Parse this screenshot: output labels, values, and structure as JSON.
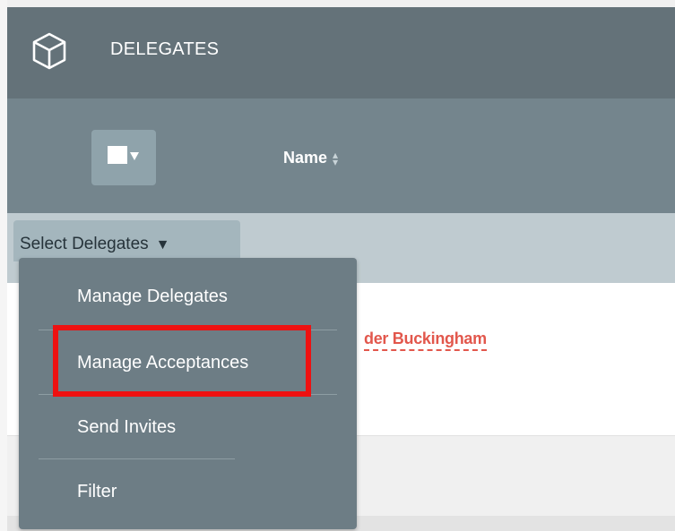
{
  "header": {
    "title": "DELEGATES",
    "icon": "cube-icon"
  },
  "table": {
    "name_column": "Name",
    "sort_icon": "sort-icon",
    "view_icon": "view-toggle-icon"
  },
  "select_button": {
    "label": "Select Delegates",
    "caret": "▼"
  },
  "row": {
    "name_fragment": "der Buckingham"
  },
  "dropdown": {
    "items": [
      "Manage Delegates",
      "Manage Acceptances",
      "Send Invites",
      "Filter"
    ]
  },
  "colors": {
    "header_bg": "#647279",
    "table_header_bg": "#74858d",
    "dropdown_bg": "#6d7d85",
    "link": "#e2574c",
    "highlight": "#ee1111"
  }
}
